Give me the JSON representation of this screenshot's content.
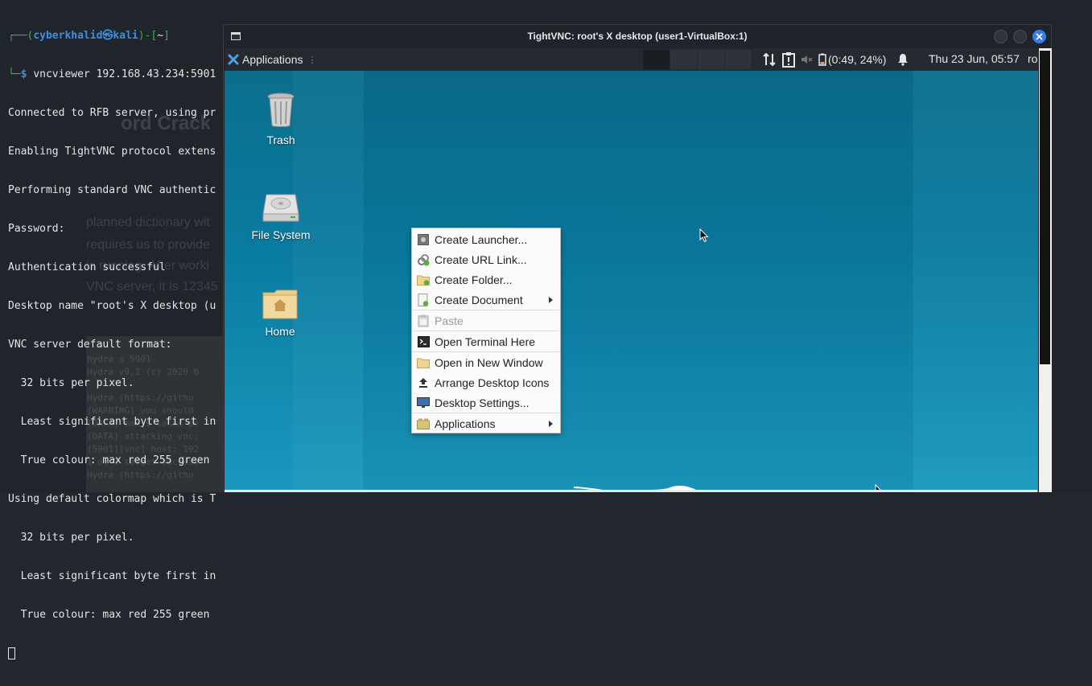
{
  "terminal": {
    "prompt_user": "cyberkhalid",
    "prompt_at": "㉿",
    "prompt_host": "kali",
    "prompt_dir": "~",
    "command": "vncviewer 192.168.43.234:5901",
    "lines": [
      "Connected to RFB server, using pr",
      "Enabling TightVNC protocol extens",
      "Performing standard VNC authentic",
      "Password:",
      "Authentication successful",
      "Desktop name \"root's X desktop (u",
      "VNC server default format:",
      "  32 bits per pixel.",
      "  Least significant byte first in",
      "  True colour: max red 255 green",
      "Using default colormap which is T",
      "  32 bits per pixel.",
      "  Least significant byte first in",
      "  True colour: max red 255 green"
    ]
  },
  "background_article": {
    "heading": "ord Crack",
    "paragraph_lines": [
      "planned dictionary wit",
      "requires us to provide",
      "is running. After worki",
      "VNC server, it is 12345"
    ],
    "code_lines": [
      "hydra  s 5901",
      "Hydra v9.1 (c) 2020 b",
      "Hydra (https://githu",
      "[WARNING] you should",
      "[DATA] max 9 tasks pe",
      "[DATA] attacking vnc:",
      "[5901][vnc] host: 192",
      "1 of 1 target success",
      "Hydra (https://githu"
    ]
  },
  "vnc_window": {
    "title": "TightVNC: root's X desktop (user1-VirtualBox:1)"
  },
  "xfce_panel": {
    "applications_label": "Applications",
    "battery": "(0:49, 24%)",
    "clock": "Thu 23 Jun, 05:57",
    "user": "ro"
  },
  "desktop_icons": {
    "trash": "Trash",
    "filesystem": "File System",
    "home": "Home"
  },
  "context_menu": {
    "items": [
      {
        "label": "Create Launcher...",
        "icon": "launcher-icon"
      },
      {
        "label": "Create URL Link...",
        "icon": "url-link-icon"
      },
      {
        "label": "Create Folder...",
        "icon": "folder-add-icon"
      },
      {
        "label": "Create Document",
        "icon": "document-add-icon",
        "submenu": true
      },
      {
        "label": "Paste",
        "icon": "paste-icon",
        "disabled": true
      },
      {
        "label": "Open Terminal Here",
        "icon": "terminal-icon"
      },
      {
        "label": "Open in New Window",
        "icon": "folder-icon"
      },
      {
        "label": "Arrange Desktop Icons",
        "icon": "arrange-icon"
      },
      {
        "label": "Desktop Settings...",
        "icon": "monitor-icon"
      },
      {
        "label": "Applications",
        "icon": "applications-icon",
        "submenu": true
      }
    ]
  },
  "colors": {
    "desktop_blue": "#0a7ba0",
    "panel_bg": "#252a31",
    "close_button": "#367bf0",
    "prompt_user": "#3d8fe0",
    "prompt_frame": "#3fae4a"
  }
}
